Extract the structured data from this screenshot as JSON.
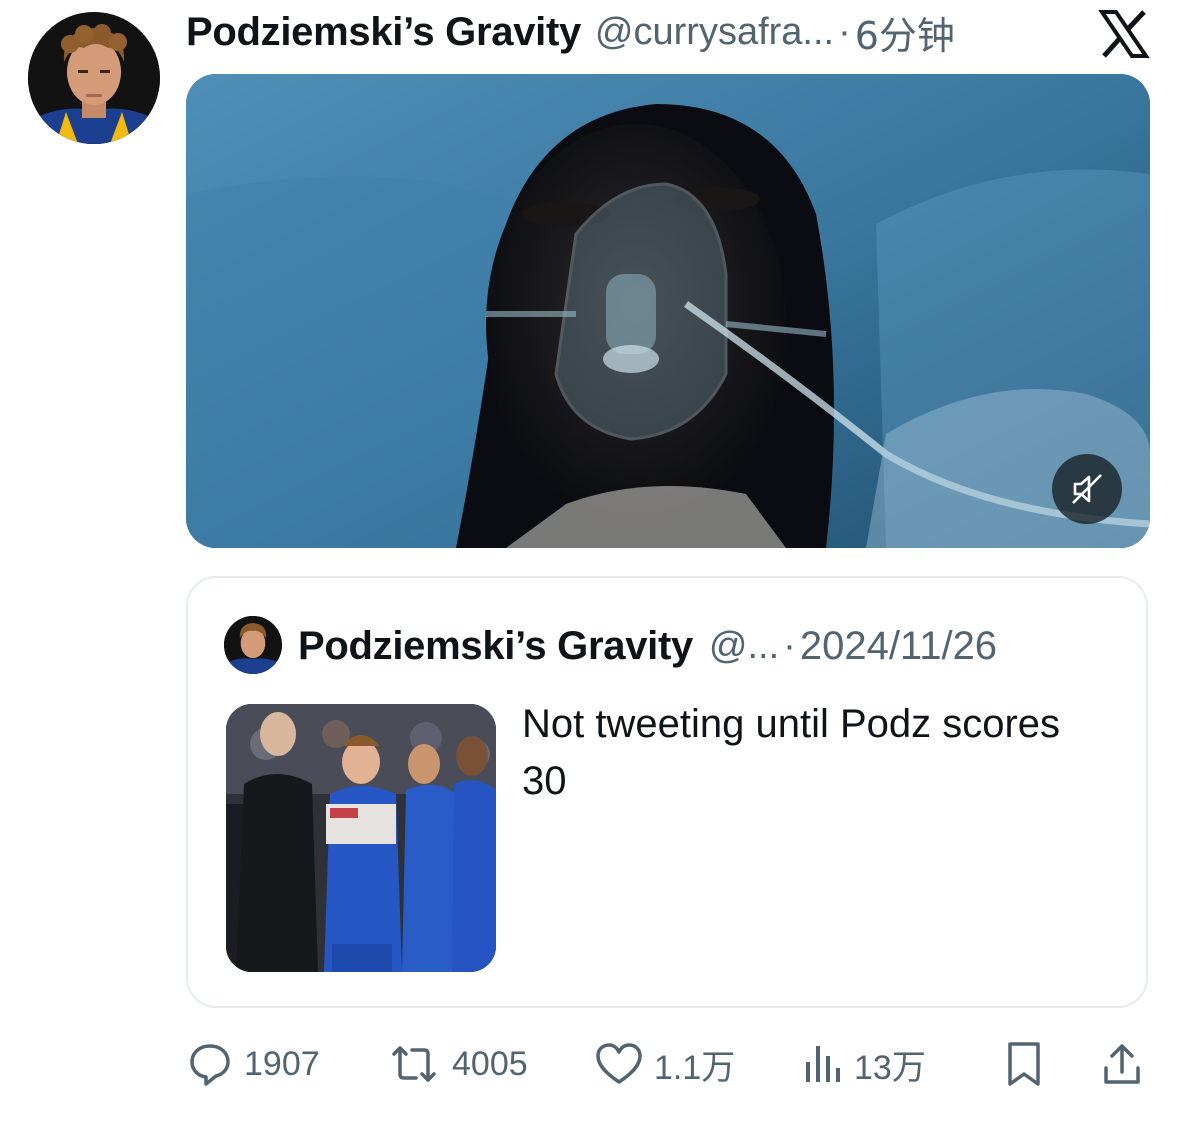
{
  "tweet": {
    "display_name": "Podziemski’s Gravity",
    "handle": "@currysafra...",
    "separator": "·",
    "time": "6分钟"
  },
  "quoted": {
    "display_name": "Podziemski’s Gravity",
    "handle": "@...",
    "separator": "·",
    "date": "2024/11/26",
    "text": "Not tweeting until Podz scores 30"
  },
  "actions": {
    "replies": "1907",
    "retweets": "4005",
    "likes": "1.1万",
    "views": "13万"
  },
  "icons": {
    "brand": "x-logo-icon",
    "mute": "volume-muted-icon",
    "reply": "reply-icon",
    "retweet": "retweet-icon",
    "like": "heart-icon",
    "views": "views-icon",
    "bookmark": "bookmark-icon",
    "share": "share-icon"
  },
  "colors": {
    "text": "#0f1419",
    "muted": "#536471",
    "border": "#e6ecf0"
  }
}
